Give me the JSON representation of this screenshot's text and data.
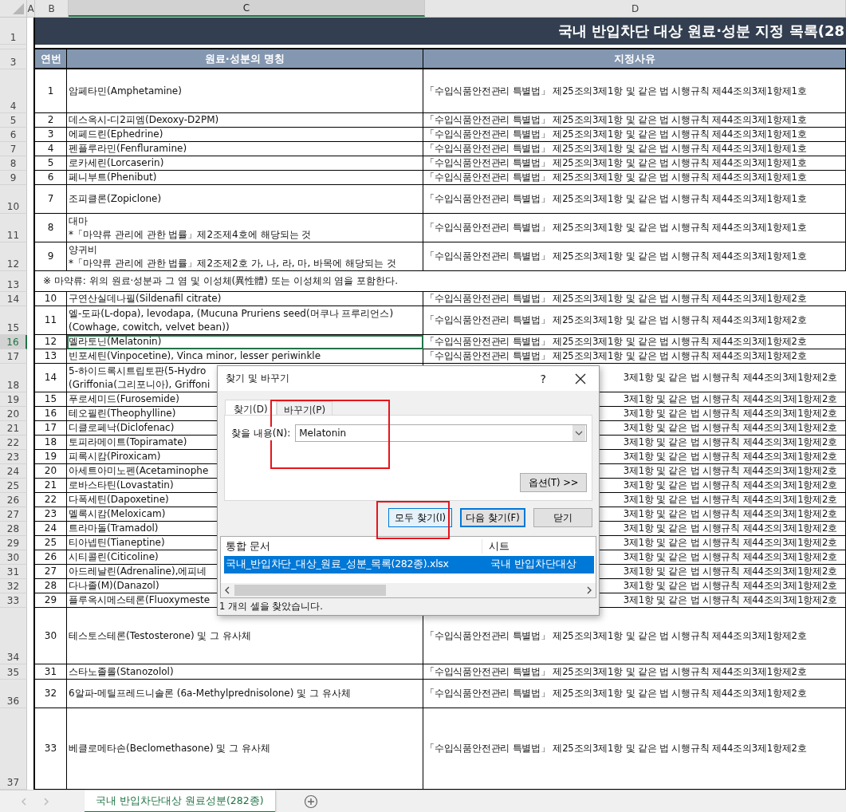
{
  "columns": [
    {
      "label": "A",
      "selected": false
    },
    {
      "label": "B",
      "selected": false
    },
    {
      "label": "C",
      "selected": true
    },
    {
      "label": "D",
      "selected": false
    }
  ],
  "title_row": {
    "row": "1",
    "text": "국내 반입차단 대상 원료·성분 지정 목록(28"
  },
  "header_row": {
    "row": "3",
    "cells": [
      "연번",
      "원료·성분의 명칭",
      "지정사유"
    ]
  },
  "rows": [
    {
      "row": "4",
      "kind": "entry",
      "selected": false,
      "no": "1",
      "name": "암페타민(Amphetamine)",
      "reason": "「수입식품안전관리 특별법」 제25조의3제1항 및 같은 법 시행규칙 제44조의3제1항제1호"
    },
    {
      "row": "5",
      "kind": "entry",
      "selected": false,
      "no": "2",
      "name": "데스옥시-디2피엠(Dexoxy-D2PM)",
      "reason": "「수입식품안전관리 특별법」 제25조의3제1항 및 같은 법 시행규칙 제44조의3제1항제1호"
    },
    {
      "row": "6",
      "kind": "entry",
      "selected": false,
      "no": "3",
      "name": "에페드린(Ephedrine)",
      "reason": "「수입식품안전관리 특별법」 제25조의3제1항 및 같은 법 시행규칙 제44조의3제1항제1호"
    },
    {
      "row": "7",
      "kind": "entry",
      "selected": false,
      "no": "4",
      "name": "펜플루라민(Fenfluramine)",
      "reason": "「수입식품안전관리 특별법」 제25조의3제1항 및 같은 법 시행규칙 제44조의3제1항제1호"
    },
    {
      "row": "8",
      "kind": "entry",
      "selected": false,
      "no": "5",
      "name": "로카세린(Lorcaserin)",
      "reason": "「수입식품안전관리 특별법」 제25조의3제1항 및 같은 법 시행규칙 제44조의3제1항제1호"
    },
    {
      "row": "9",
      "kind": "entry",
      "selected": false,
      "no": "6",
      "name": "페니부트(Phenibut)",
      "reason": "「수입식품안전관리 특별법」 제25조의3제1항 및 같은 법 시행규칙 제44조의3제1항제1호"
    },
    {
      "row": "10",
      "kind": "entry",
      "selected": false,
      "no": "7",
      "name": "조피클론(Zopiclone)",
      "reason": "「수입식품안전관리 특별법」 제25조의3제1항 및 같은 법 시행규칙 제44조의3제1항제1호"
    },
    {
      "row": "11",
      "kind": "entry",
      "selected": false,
      "no": "8",
      "name": "대마\n*「마약류 관리에 관한 법률」제2조제4호에 해당되는 것",
      "reason": "「수입식품안전관리 특별법」 제25조의3제1항 및 같은 법 시행규칙 제44조의3제1항제1호"
    },
    {
      "row": "12",
      "kind": "entry",
      "selected": false,
      "no": "9",
      "name": "양귀비\n*「마약류 관리에 관한 법률」제2조제2호 가, 나, 라, 마, 바목에 해당되는 것",
      "reason": "「수입식품안전관리 특별법」 제25조의3제1항 및 같은 법 시행규칙 제44조의3제1항제1호"
    },
    {
      "row": "13",
      "kind": "note",
      "selected": false,
      "text": "※ 마약류: 위의 원료·성분과 그 염 및 이성체(異性體) 또는 이성체의 염을 포함한다."
    },
    {
      "row": "14",
      "kind": "entry",
      "selected": false,
      "no": "10",
      "name": "구연산실데나필(Sildenafil citrate)",
      "reason": "「수입식품안전관리 특별법」 제25조의3제1항 및 같은 법 시행규칙 제44조의3제1항제2호"
    },
    {
      "row": "15",
      "kind": "entry",
      "selected": false,
      "no": "11",
      "name": "엘-도파(L-dopa), levodapa, (Mucuna Pruriens seed(머쿠나 프루리언스)\n(Cowhage, cowitch, velvet bean))",
      "reason": "「수입식품안전관리 특별법」 제25조의3제1항 및 같은 법 시행규칙 제44조의3제1항제2호"
    },
    {
      "row": "16",
      "kind": "entry",
      "selected": true,
      "no": "12",
      "name": "멜라토닌(Melatonin)",
      "reason": "「수입식품안전관리 특별법」 제25조의3제1항 및 같은 법 시행규칙 제44조의3제1항제2호"
    },
    {
      "row": "17",
      "kind": "entry",
      "selected": false,
      "no": "13",
      "name": "빈포세틴(Vinpocetine), Vinca minor, lesser periwinkle",
      "reason": "「수입식품안전관리 특별법」 제25조의3제1항 및 같은 법 시행규칙 제44조의3제1항제2호"
    },
    {
      "row": "18",
      "kind": "covered",
      "selected": false,
      "no": "14",
      "name": "5-하이드록시트립토판(5-Hydro\n(Griffonia(그리포니아), Griffoni",
      "reason": "3제1항 및 같은 법 시행규칙 제44조의3제1항제2호"
    },
    {
      "row": "19",
      "kind": "covered",
      "selected": false,
      "no": "15",
      "name": "푸로세미드(Furosemide)",
      "reason": "3제1항 및 같은 법 시행규칙 제44조의3제1항제2호"
    },
    {
      "row": "20",
      "kind": "covered",
      "selected": false,
      "no": "16",
      "name": "테오필린(Theophylline)",
      "reason": "3제1항 및 같은 법 시행규칙 제44조의3제1항제2호"
    },
    {
      "row": "21",
      "kind": "covered",
      "selected": false,
      "no": "17",
      "name": "디클로페낙(Diclofenac)",
      "reason": "3제1항 및 같은 법 시행규칙 제44조의3제1항제2호"
    },
    {
      "row": "22",
      "kind": "covered",
      "selected": false,
      "no": "18",
      "name": "토피라메이트(Topiramate)",
      "reason": "3제1항 및 같은 법 시행규칙 제44조의3제1항제2호"
    },
    {
      "row": "23",
      "kind": "covered",
      "selected": false,
      "no": "19",
      "name": "피록시캄(Piroxicam)",
      "reason": "3제1항 및 같은 법 시행규칙 제44조의3제1항제2호"
    },
    {
      "row": "24",
      "kind": "covered",
      "selected": false,
      "no": "20",
      "name": "아세트아미노펜(Acetaminophe",
      "reason": "3제1항 및 같은 법 시행규칙 제44조의3제1항제2호"
    },
    {
      "row": "25",
      "kind": "covered",
      "selected": false,
      "no": "21",
      "name": "로바스타틴(Lovastatin)",
      "reason": "3제1항 및 같은 법 시행규칙 제44조의3제1항제2호"
    },
    {
      "row": "26",
      "kind": "covered",
      "selected": false,
      "no": "22",
      "name": "다폭세틴(Dapoxetine)",
      "reason": "3제1항 및 같은 법 시행규칙 제44조의3제1항제2호"
    },
    {
      "row": "27",
      "kind": "covered",
      "selected": false,
      "no": "23",
      "name": "멜록시캄(Meloxicam)",
      "reason": "3제1항 및 같은 법 시행규칙 제44조의3제1항제2호"
    },
    {
      "row": "28",
      "kind": "covered",
      "selected": false,
      "no": "24",
      "name": "트라마돌(Tramadol)",
      "reason": "3제1항 및 같은 법 시행규칙 제44조의3제1항제2호"
    },
    {
      "row": "29",
      "kind": "covered",
      "selected": false,
      "no": "25",
      "name": "티아넵틴(Tianeptine)",
      "reason": "3제1항 및 같은 법 시행규칙 제44조의3제1항제2호"
    },
    {
      "row": "30",
      "kind": "covered",
      "selected": false,
      "no": "26",
      "name": "시티콜린(Citicoline)",
      "reason": "3제1항 및 같은 법 시행규칙 제44조의3제1항제2호"
    },
    {
      "row": "31",
      "kind": "covered",
      "selected": false,
      "no": "27",
      "name": "아드레날린(Adrenaline),에피네",
      "reason": "3제1항 및 같은 법 시행규칙 제44조의3제1항제2호"
    },
    {
      "row": "32",
      "kind": "covered",
      "selected": false,
      "no": "28",
      "name": "다나졸(M)(Danazol)",
      "reason": "3제1항 및 같은 법 시행규칙 제44조의3제1항제2호"
    },
    {
      "row": "33",
      "kind": "covered",
      "selected": false,
      "no": "29",
      "name": "플루옥시메스테론(Fluoxymeste",
      "reason": "3제1항 및 같은 법 시행규칙 제44조의3제1항제2호"
    },
    {
      "row": "34",
      "kind": "entry",
      "selected": false,
      "no": "30",
      "name": "테스토스테론(Testosterone) 및 그 유사체",
      "reason": "「수입식품안전관리 특별법」 제25조의3제1항 및 같은 법 시행규칙 제44조의3제1항제2호"
    },
    {
      "row": "35",
      "kind": "entry",
      "selected": false,
      "no": "31",
      "name": "스타노졸롤(Stanozolol)",
      "reason": "「수입식품안전관리 특별법」 제25조의3제1항 및 같은 법 시행규칙 제44조의3제1항제2호"
    },
    {
      "row": "36",
      "kind": "entry",
      "selected": false,
      "no": "32",
      "name": "6알파-메틸프레드니솔론 (6a-Methylprednisolone) 및 그 유사체",
      "reason": "「수입식품안전관리 특별법」 제25조의3제1항 및 같은 법 시행규칙 제44조의3제1항제2호"
    },
    {
      "row": "37",
      "kind": "entry",
      "selected": false,
      "no": "33",
      "name": "베클로메타손(Beclomethasone) 및 그 유사체",
      "reason": "「수입식품안전관리 특별법」 제25조의3제1항 및 같은 법 시행규칙 제44조의3제1항제2호"
    }
  ],
  "sheet_tabs": [
    {
      "label": "국내 반입차단대상 원료성분(282종)",
      "selected": true
    }
  ],
  "dialog": {
    "title": "찾기 및 바꾸기",
    "help": "?",
    "tabs": [
      {
        "label": "찾기(D)",
        "selected": true
      },
      {
        "label": "바꾸기(P)",
        "selected": false
      }
    ],
    "find_label": "찾을 내용(N):",
    "find_value": "Melatonin",
    "options_button": "옵션(T) >>",
    "buttons": [
      {
        "label": "모두 찾기(I)",
        "kind": "normal"
      },
      {
        "label": "다음 찾기(F)",
        "kind": "default"
      },
      {
        "label": "닫기",
        "kind": "normal"
      }
    ],
    "results": {
      "columns": [
        "통합 문서",
        "시트"
      ],
      "rows": [
        {
          "workbook": "국내_반입차단_대상_원료_성분_목록(282종).xlsx",
          "sheet": "국내 반입차단대상",
          "selected": true
        }
      ]
    },
    "status": "1 개의 셀을 찾았습니다."
  }
}
